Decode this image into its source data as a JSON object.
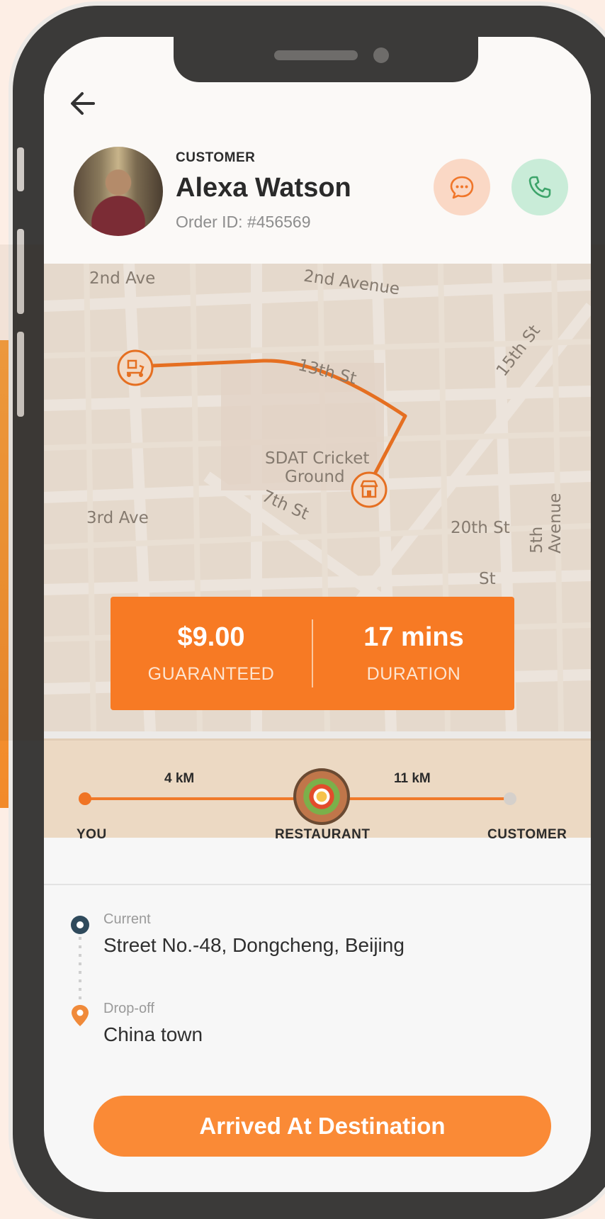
{
  "header": {
    "role_label": "CUSTOMER",
    "customer_name": "Alexa Watson",
    "order_id": "Order ID: #456569"
  },
  "map": {
    "streets": [
      "2nd Ave",
      "2nd Avenue",
      "13th St",
      "15th St",
      "SDAT Cricket",
      "Ground",
      "7th St",
      "3rd Ave",
      "20th St",
      "5th Avenue",
      "St"
    ]
  },
  "stats": {
    "price_value": "$9.00",
    "price_label": "GUARANTEED",
    "duration_value": "17 mins",
    "duration_label": "DURATION"
  },
  "progress": {
    "dist_to_restaurant": "4 kM",
    "dist_to_customer": "11 kM",
    "nodes": [
      "YOU",
      "RESTAURANT",
      "CUSTOMER"
    ]
  },
  "locations": {
    "current_label": "Current",
    "current_value": "Street No.-48, Dongcheng, Beijing",
    "dropoff_label": "Drop-off",
    "dropoff_value": "China town"
  },
  "action": {
    "cta_label": "Arrived At Destination"
  },
  "colors": {
    "accent": "#f77a24",
    "button": "#fa8a36",
    "call_bg": "#c9ecd8",
    "chat_bg": "#fad8c5"
  }
}
